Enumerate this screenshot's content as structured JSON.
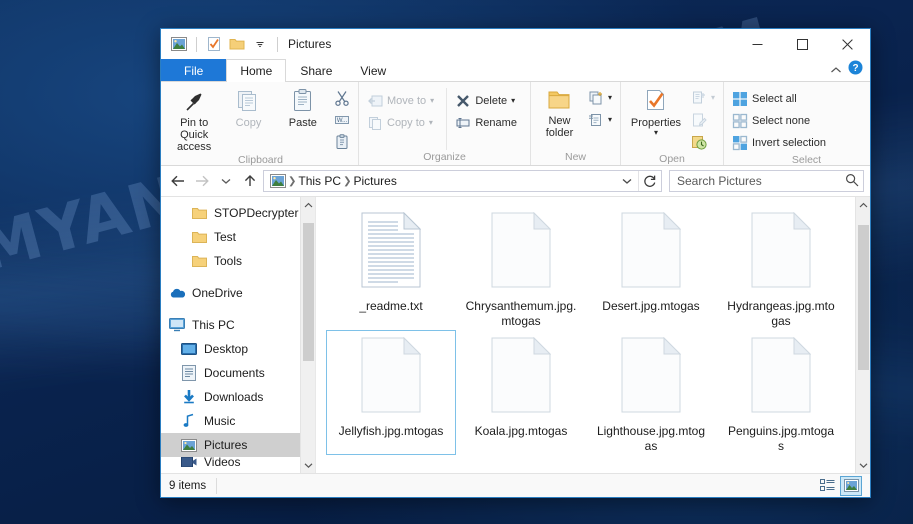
{
  "desktop": {
    "watermark": "MYANTISPYWARE.COM"
  },
  "window": {
    "title": "Pictures",
    "quick_access": {
      "folder_icon": "pictures-icon",
      "properties_icon": "properties-checklist-icon",
      "new_folder_icon": "new-folder-icon",
      "dropdown_icon": "chevron-down-icon"
    },
    "controls": {
      "minimize": "—",
      "maximize": "❐",
      "close": "✕"
    }
  },
  "tabs": [
    {
      "label": "File",
      "type": "file"
    },
    {
      "label": "Home",
      "type": "active"
    },
    {
      "label": "Share",
      "type": "normal"
    },
    {
      "label": "View",
      "type": "normal"
    }
  ],
  "tab_right": {
    "collapse_icon": "chevron-up-icon",
    "help_icon": "help-icon"
  },
  "ribbon": {
    "groups": [
      {
        "label": "Clipboard",
        "big_buttons": [
          {
            "label": "Pin to Quick access",
            "icon": "pin-icon",
            "disabled": false
          },
          {
            "label": "Copy",
            "icon": "copy-icon",
            "disabled": true
          },
          {
            "label": "Paste",
            "icon": "paste-icon",
            "disabled": false
          }
        ],
        "small_buttons": [
          {
            "label": "",
            "icon": "cut-scissors-icon",
            "disabled": false
          },
          {
            "label": "",
            "icon": "copy-path-icon",
            "disabled": false
          },
          {
            "label": "",
            "icon": "paste-shortcut-icon",
            "disabled": false
          }
        ]
      },
      {
        "label": "Organize",
        "small_buttons": [
          {
            "label": "Move to",
            "icon": "move-to-icon",
            "disabled": true,
            "dropdown": true
          },
          {
            "label": "Copy to",
            "icon": "copy-to-icon",
            "disabled": true,
            "dropdown": true
          },
          {
            "label": "Delete",
            "icon": "delete-x-icon",
            "disabled": false,
            "dropdown": true
          },
          {
            "label": "Rename",
            "icon": "rename-icon",
            "disabled": false,
            "dropdown": false
          }
        ]
      },
      {
        "label": "New",
        "big_buttons": [
          {
            "label": "New folder",
            "icon": "new-folder-icon",
            "disabled": false
          }
        ],
        "small_buttons": [
          {
            "label": "",
            "icon": "new-item-icon",
            "disabled": false,
            "dropdown": true
          },
          {
            "label": "",
            "icon": "easy-access-icon",
            "disabled": false,
            "dropdown": true
          }
        ]
      },
      {
        "label": "Open",
        "big_buttons": [
          {
            "label": "Properties",
            "icon": "properties-checklist-icon",
            "disabled": false,
            "dropdown": true
          }
        ],
        "small_buttons": [
          {
            "label": "",
            "icon": "open-icon",
            "disabled": true,
            "dropdown": true
          },
          {
            "label": "",
            "icon": "edit-icon",
            "disabled": true
          },
          {
            "label": "",
            "icon": "history-icon",
            "disabled": false
          }
        ]
      },
      {
        "label": "Select",
        "small_buttons": [
          {
            "label": "Select all",
            "icon": "select-all-icon",
            "disabled": false
          },
          {
            "label": "Select none",
            "icon": "select-none-icon",
            "disabled": false
          },
          {
            "label": "Invert selection",
            "icon": "invert-selection-icon",
            "disabled": false
          }
        ]
      }
    ]
  },
  "addressbar": {
    "back_icon": "arrow-left-icon",
    "forward_icon": "arrow-right-icon",
    "recent_icon": "chevron-down-icon",
    "up_icon": "arrow-up-icon",
    "path_icon": "pictures-icon",
    "breadcrumbs": [
      "This PC",
      "Pictures"
    ],
    "dropdown_icon": "chevron-down-icon",
    "refresh_icon": "refresh-icon",
    "search_placeholder": "Search Pictures",
    "search_value": "",
    "search_icon": "search-icon"
  },
  "navpane": {
    "items": [
      {
        "label": "STOPDecrypter",
        "icon": "folder-icon",
        "indent": 2,
        "selected": false
      },
      {
        "label": "Test",
        "icon": "folder-icon",
        "indent": 2,
        "selected": false
      },
      {
        "label": "Tools",
        "icon": "folder-icon",
        "indent": 2,
        "selected": false
      },
      {
        "label": "OneDrive",
        "icon": "onedrive-cloud-icon",
        "indent": 0,
        "selected": false,
        "spaced": true
      },
      {
        "label": "This PC",
        "icon": "this-pc-icon",
        "indent": 0,
        "selected": false,
        "spaced": true
      },
      {
        "label": "Desktop",
        "icon": "desktop-icon",
        "indent": 1,
        "selected": false
      },
      {
        "label": "Documents",
        "icon": "documents-icon",
        "indent": 1,
        "selected": false
      },
      {
        "label": "Downloads",
        "icon": "downloads-icon",
        "indent": 1,
        "selected": false
      },
      {
        "label": "Music",
        "icon": "music-note-icon",
        "indent": 1,
        "selected": false
      },
      {
        "label": "Pictures",
        "icon": "pictures-icon",
        "indent": 1,
        "selected": true
      },
      {
        "label": "Videos",
        "icon": "videos-icon",
        "indent": 1,
        "selected": false
      }
    ],
    "scroll_up_icon": "chevron-up-icon",
    "scroll_down_icon": "chevron-down-icon"
  },
  "files": [
    {
      "name": "_readme.txt",
      "icon": "text-file-icon",
      "selected": false
    },
    {
      "name": "Chrysanthemum.jpg.mtogas",
      "icon": "blank-file-icon",
      "selected": false
    },
    {
      "name": "Desert.jpg.mtogas",
      "icon": "blank-file-icon",
      "selected": false
    },
    {
      "name": "Hydrangeas.jpg.mtogas",
      "icon": "blank-file-icon",
      "selected": false
    },
    {
      "name": "Jellyfish.jpg.mtogas",
      "icon": "blank-file-icon",
      "selected": true
    },
    {
      "name": "Koala.jpg.mtogas",
      "icon": "blank-file-icon",
      "selected": false
    },
    {
      "name": "Lighthouse.jpg.mtogas",
      "icon": "blank-file-icon",
      "selected": false
    },
    {
      "name": "Penguins.jpg.mtogas",
      "icon": "blank-file-icon",
      "selected": false
    }
  ],
  "content_scroll": {
    "up_icon": "chevron-up-icon",
    "down_icon": "chevron-down-icon"
  },
  "statusbar": {
    "item_count": "9 items",
    "details_view_icon": "details-view-icon",
    "large_icons_view_icon": "large-icons-view-icon"
  },
  "colors": {
    "accent": "#1e78d7",
    "selection_border": "#7ec1e8",
    "nav_selected_bg": "#cfcfcf",
    "folder_yellow": "#f6d17a"
  }
}
